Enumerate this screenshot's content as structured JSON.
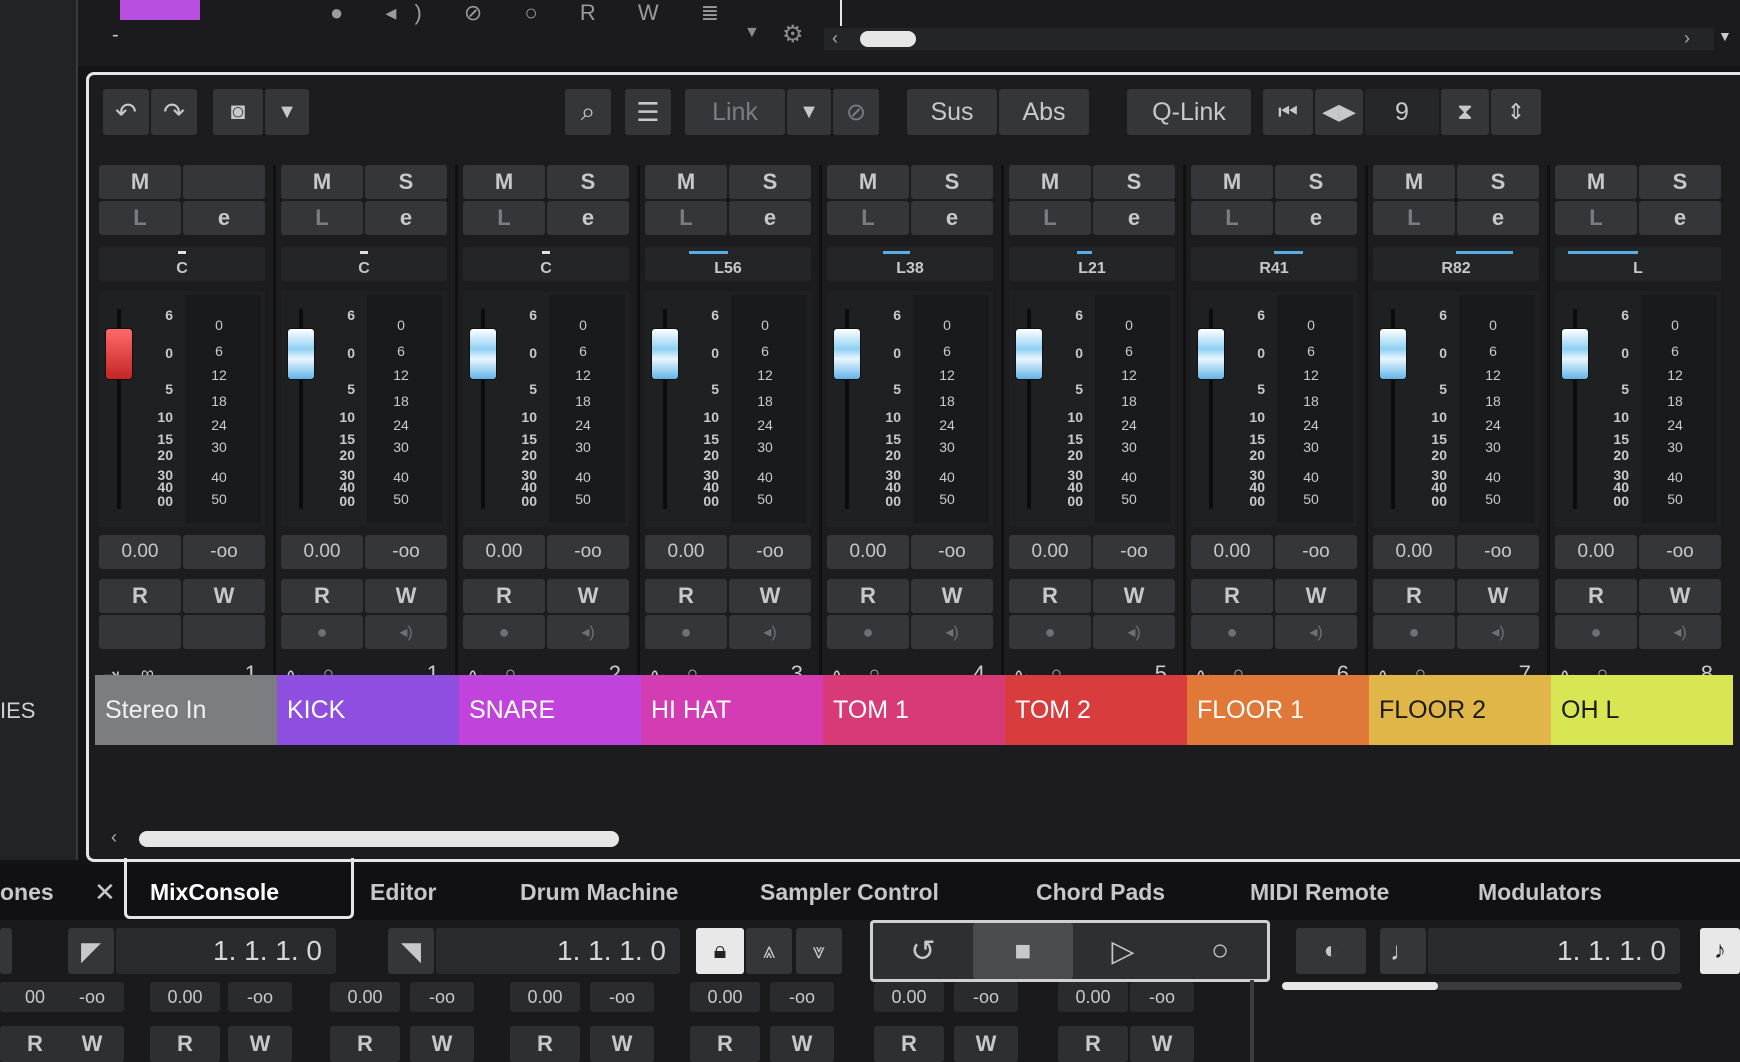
{
  "top": {
    "dash": "-"
  },
  "left_panel": {
    "label": "IES",
    "tab_partial": "ones"
  },
  "toolbar": {
    "link_label": "Link",
    "sus_label": "Sus",
    "abs_label": "Abs",
    "qlink_label": "Q-Link",
    "channel_count": "9"
  },
  "strip_labels": {
    "mute": "M",
    "solo": "S",
    "listen": "L",
    "edit": "e",
    "read": "R",
    "write": "W"
  },
  "channels": [
    {
      "name": "Stereo In",
      "pan": "C",
      "volume": "0.00",
      "peak": "-oo",
      "number": "1",
      "color": "#7c7d80"
    },
    {
      "name": "KICK",
      "pan": "C",
      "volume": "0.00",
      "peak": "-oo",
      "number": "1",
      "color": "#8e4fe0"
    },
    {
      "name": "SNARE",
      "pan": "C",
      "volume": "0.00",
      "peak": "-oo",
      "number": "2",
      "color": "#c044db"
    },
    {
      "name": "HI HAT",
      "pan": "L56",
      "volume": "0.00",
      "peak": "-oo",
      "number": "3",
      "color": "#d43cb4"
    },
    {
      "name": "TOM 1",
      "pan": "L38",
      "volume": "0.00",
      "peak": "-oo",
      "number": "4",
      "color": "#d83a77"
    },
    {
      "name": "TOM 2",
      "pan": "L21",
      "volume": "0.00",
      "peak": "-oo",
      "number": "5",
      "color": "#d83c3c"
    },
    {
      "name": "FLOOR 1",
      "pan": "R41",
      "volume": "0.00",
      "peak": "-oo",
      "number": "6",
      "color": "#e07838"
    },
    {
      "name": "FLOOR 2",
      "pan": "R82",
      "volume": "0.00",
      "peak": "-oo",
      "number": "7",
      "color": "#e0b648"
    },
    {
      "name": "OH L",
      "pan": "L",
      "volume": "0.00",
      "peak": "-oo",
      "number": "8",
      "color": "#d9e653"
    }
  ],
  "fader_scale": [
    "6",
    "0",
    "5",
    "10",
    "15",
    "20",
    "30",
    "40",
    "00"
  ],
  "meter_scale": [
    "0",
    "6",
    "12",
    "18",
    "24",
    "30",
    "40",
    "50"
  ],
  "tabs": [
    "MixConsole",
    "Editor",
    "Drum Machine",
    "Sampler Control",
    "Chord Pads",
    "MIDI Remote",
    "Modulators"
  ],
  "active_tab": "MixConsole",
  "transport": {
    "left_locator": "1. 1. 1.   0",
    "right_locator": "1. 1. 1.   0",
    "position": "1. 1. 1.   0"
  },
  "bottom_row": {
    "values": [
      "00",
      "-oo",
      "0.00",
      "-oo",
      "0.00",
      "-oo",
      "0.00",
      "-oo",
      "0.00",
      "-oo",
      "0.00",
      "-oo",
      "0.00",
      "-oo"
    ],
    "rw": [
      "R",
      "W",
      "R",
      "W",
      "R",
      "W",
      "R",
      "W",
      "R",
      "W",
      "R",
      "W",
      "R",
      "W"
    ]
  }
}
